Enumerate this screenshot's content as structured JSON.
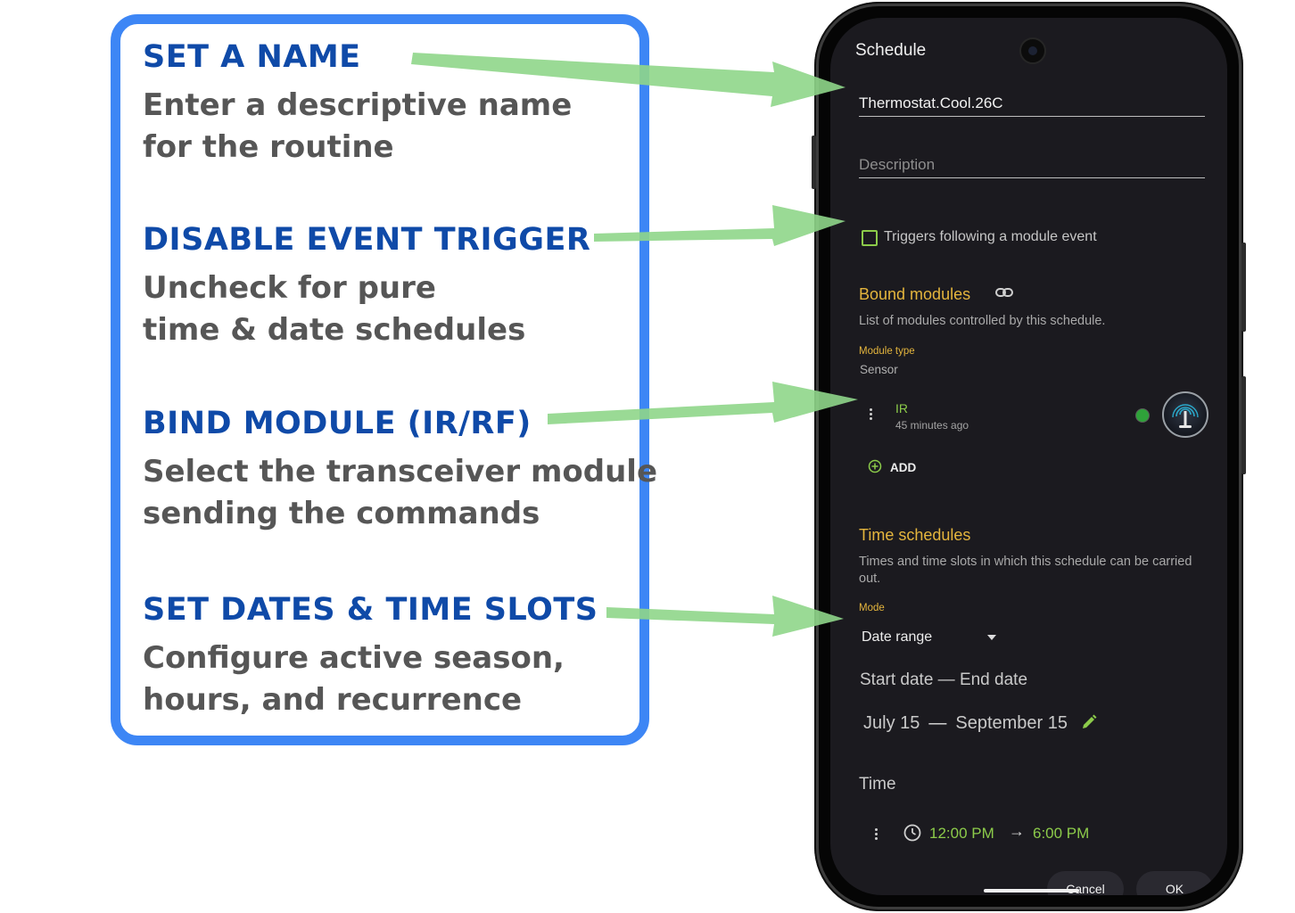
{
  "annotations": [
    {
      "heading": "SET A NAME",
      "body": [
        "Enter a descriptive name",
        "for the routine"
      ]
    },
    {
      "heading": "DISABLE EVENT TRIGGER",
      "body": [
        "Uncheck for pure",
        "time & date schedules"
      ]
    },
    {
      "heading": "BIND MODULE (IR/RF)",
      "body": [
        "Select the transceiver module",
        "sending the commands"
      ]
    },
    {
      "heading": "SET DATES & TIME SLOTS",
      "body": [
        "Configure active season,",
        "hours, and recurrence"
      ]
    }
  ],
  "colors": {
    "annotation_border": "#3d86f5",
    "annotation_heading": "#0f4aa8",
    "annotation_body": "#565656",
    "arrow": "#8fd68a",
    "screen_bg": "#1b1a1f",
    "section_title": "#e4b53d",
    "accent_green": "#8ccb4a"
  },
  "app": {
    "title": "Schedule",
    "name_value": "Thermostat.Cool.26C",
    "description_placeholder": "Description",
    "trigger_checkbox": {
      "label": "Triggers following a module event",
      "checked": false
    },
    "bound_modules": {
      "title": "Bound modules",
      "icon": "link-icon",
      "subtitle": "List of modules controlled by this schedule.",
      "module_type_label": "Module type",
      "module_type_value": "Sensor",
      "module": {
        "name": "IR",
        "last_seen": "45 minutes ago",
        "status_color": "#2fa23a",
        "icon": "ir-transceiver-icon"
      },
      "add_label": "ADD"
    },
    "time_schedules": {
      "title": "Time schedules",
      "subtitle_line1": "Times and time slots in which this schedule can be carried",
      "subtitle_line2": "out.",
      "mode_label": "Mode",
      "mode_value": "Date range",
      "range_title": "Start date — End date",
      "start_date": "July 15",
      "end_date": "September 15",
      "time_title": "Time",
      "time_start": "12:00 PM",
      "time_end": "6:00 PM"
    },
    "buttons": {
      "cancel": "Cancel",
      "ok": "OK"
    }
  }
}
